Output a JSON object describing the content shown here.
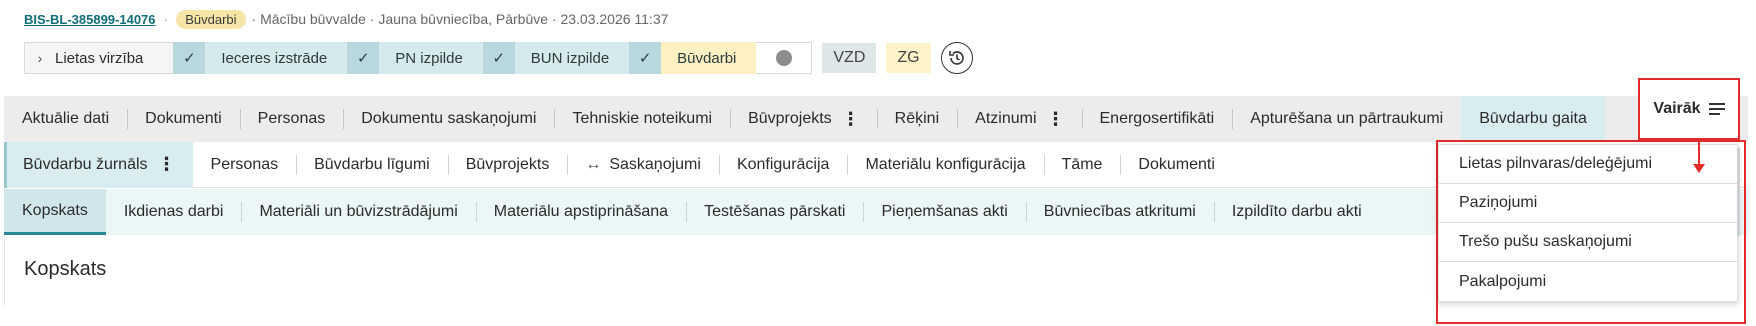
{
  "header": {
    "case_id": "BIS-BL-385899-14076",
    "separator": "·",
    "stage_badge": "Būvdarbi",
    "meta": "· Mācību būvvalde · Jauna būvniecība, Pārbūve · 23.03.2026 11:37"
  },
  "progress": {
    "first_label": "Lietas virzība",
    "stages": [
      {
        "label": "Ieceres izstrāde",
        "done": true
      },
      {
        "label": "PN izpilde",
        "done": true
      },
      {
        "label": "BUN izpilde",
        "done": true
      },
      {
        "label": "Būvdarbi",
        "done": true,
        "current": true
      }
    ],
    "vzd": "VZD",
    "zg": "ZG"
  },
  "main_tabs": [
    {
      "label": "Aktuālie dati"
    },
    {
      "label": "Dokumenti"
    },
    {
      "label": "Personas"
    },
    {
      "label": "Dokumentu saskaņojumi"
    },
    {
      "label": "Tehniskie noteikumi"
    },
    {
      "label": "Būvprojekts",
      "has_menu": true
    },
    {
      "label": "Rēķini"
    },
    {
      "label": "Atzinumi",
      "has_menu": true
    },
    {
      "label": "Energosertifikāti"
    },
    {
      "label": "Apturēšana un pārtraukumi"
    },
    {
      "label": "Būvdarbu gaita",
      "active": true
    }
  ],
  "more_button": {
    "label": "Vairāk"
  },
  "more_menu": [
    "Lietas pilnvaras/deleģējumi",
    "Paziņojumi",
    "Trešo pušu saskaņojumi",
    "Pakalpojumi"
  ],
  "sub_tabs": [
    {
      "label": "Būvdarbu žurnāls",
      "active": true,
      "has_menu": true
    },
    {
      "label": "Personas"
    },
    {
      "label": "Būvdarbu līgumi"
    },
    {
      "label": "Būvprojekts"
    },
    {
      "label": "Saskaņojumi",
      "icon": "↔"
    },
    {
      "label": "Konfigurācija"
    },
    {
      "label": "Materiālu konfigurācija"
    },
    {
      "label": "Tāme"
    },
    {
      "label": "Dokumenti"
    }
  ],
  "third_tabs": [
    {
      "label": "Kopskats",
      "active": true
    },
    {
      "label": "Ikdienas darbi"
    },
    {
      "label": "Materiāli un būvizstrādājumi"
    },
    {
      "label": "Materiālu apstiprināšana"
    },
    {
      "label": "Testēšanas pārskati"
    },
    {
      "label": "Pieņemšanas akti"
    },
    {
      "label": "Būvniecības atkritumi"
    },
    {
      "label": "Izpildīto darbu akti"
    }
  ],
  "page_title": "Kopskats",
  "colors": {
    "accent": "#2a8796",
    "highlight": "#e32b2b",
    "badge": "#f5e6a8"
  }
}
